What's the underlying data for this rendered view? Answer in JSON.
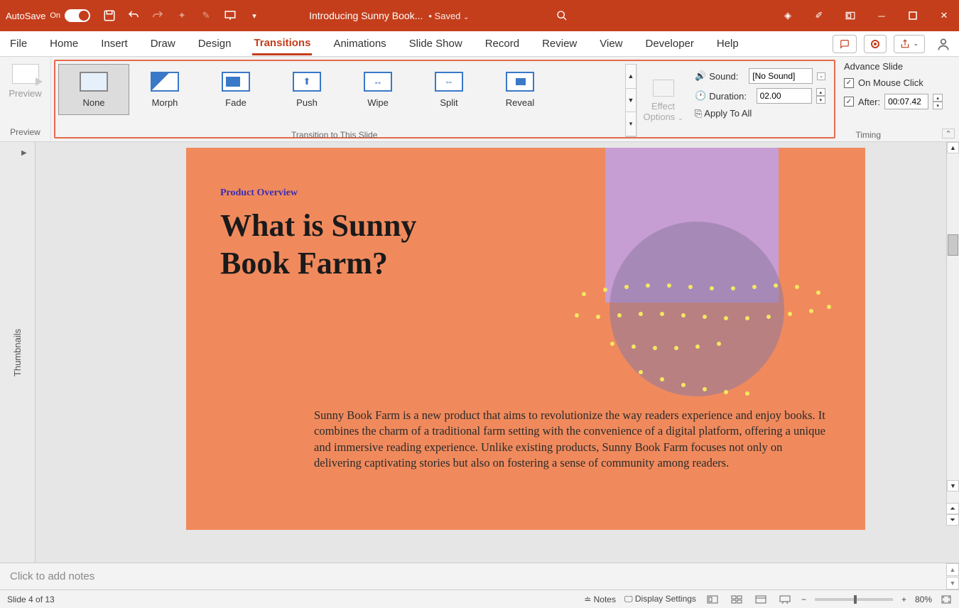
{
  "titlebar": {
    "autosave_label": "AutoSave",
    "autosave_state": "On",
    "doc_title": "Introducing Sunny Book...",
    "save_state": "• Saved"
  },
  "tabs": {
    "file": "File",
    "home": "Home",
    "insert": "Insert",
    "draw": "Draw",
    "design": "Design",
    "transitions": "Transitions",
    "animations": "Animations",
    "slideshow": "Slide Show",
    "record": "Record",
    "review": "Review",
    "view": "View",
    "developer": "Developer",
    "help": "Help"
  },
  "ribbon": {
    "preview": "Preview",
    "preview_group": "Preview",
    "transitions": {
      "none": "None",
      "morph": "Morph",
      "fade": "Fade",
      "push": "Push",
      "wipe": "Wipe",
      "split": "Split",
      "reveal": "Reveal"
    },
    "transition_group": "Transition to This Slide",
    "effect_options": "Effect",
    "effect_options2": "Options",
    "sound_label": "Sound:",
    "sound_value": "[No Sound]",
    "duration_label": "Duration:",
    "duration_value": "02.00",
    "apply_all": "Apply To All",
    "advance_header": "Advance Slide",
    "on_mouse": "On Mouse Click",
    "after_label": "After:",
    "after_value": "00:07.42",
    "timing_group": "Timing"
  },
  "thumbnails_label": "Thumbnails",
  "slide": {
    "overline": "Product Overview",
    "headline": "What is Sunny Book Farm?",
    "body": "Sunny Book Farm is a new product that aims to revolutionize the way readers experience and enjoy books. It combines the charm of a traditional farm setting with the convenience of a digital platform, offering a unique and immersive reading experience. Unlike existing products, Sunny Book Farm focuses not only on delivering captivating stories but also on fostering a sense of community among readers."
  },
  "notes_placeholder": "Click to add notes",
  "status": {
    "slide_info": "Slide 4 of 13",
    "notes": "Notes",
    "display": "Display Settings",
    "zoom": "80%"
  }
}
